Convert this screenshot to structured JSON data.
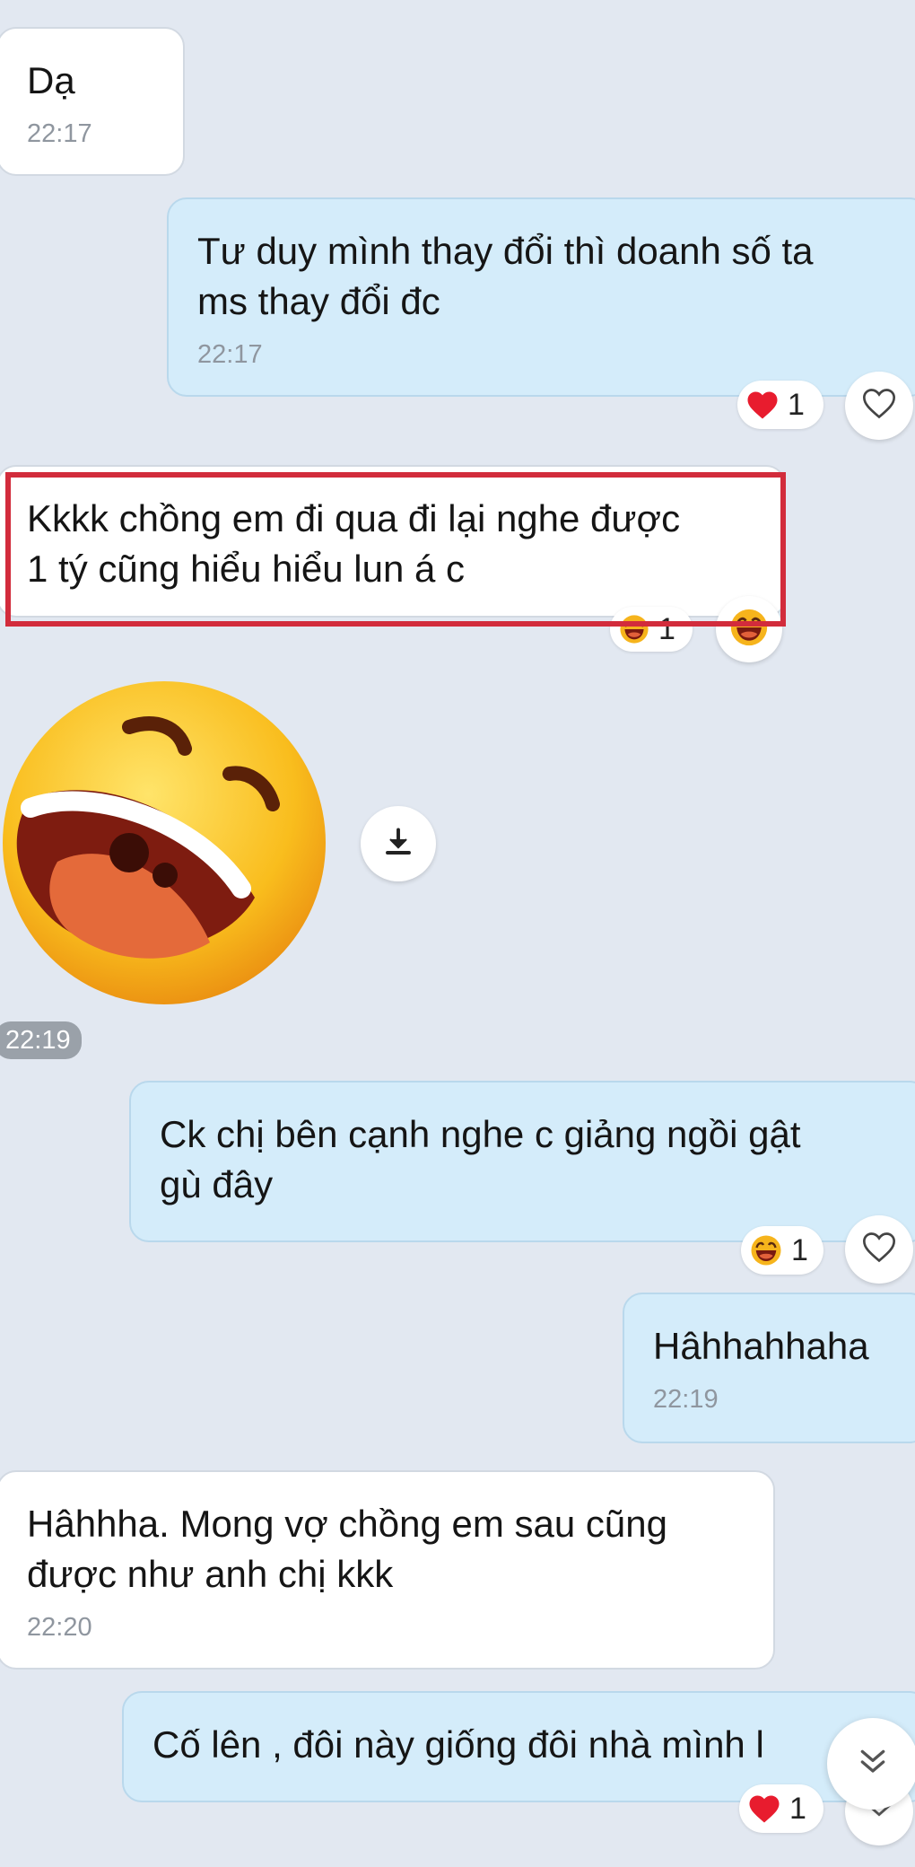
{
  "messages": [
    {
      "text": "Dạ",
      "time": "22:17"
    },
    {
      "text": "Tư duy mình thay đổi thì doanh số ta\nms thay đổi đc",
      "time": "22:17",
      "reaction": {
        "emoji": "heart",
        "count": "1"
      }
    },
    {
      "text": "Kkkk chồng em đi qua đi lại nghe được\n1 tý cũng hiểu hiểu lun á c",
      "reaction": {
        "emoji": "laugh",
        "count": "1"
      }
    },
    {
      "sticker": "laughing-face",
      "time": "22:19"
    },
    {
      "text": "Ck chị bên cạnh nghe c giảng ngồi gật\ngù đây",
      "reaction": {
        "emoji": "laugh",
        "count": "1"
      }
    },
    {
      "text": "Hâhhahhaha",
      "time": "22:19"
    },
    {
      "text": "Hâhhha. Mong vợ chồng em sau cũng\nđược như anh chị kkk",
      "time": "22:20"
    },
    {
      "text": "Cố lên , đôi này giống đôi nhà mình l",
      "reaction": {
        "emoji": "heart",
        "count": "1"
      }
    }
  ],
  "colors": {
    "background": "#e2e8f1",
    "incoming_bubble": "#ffffff",
    "outgoing_bubble": "#d4ecfa",
    "highlight": "#d22c3c"
  },
  "icons": {
    "react": "heart-outline-icon",
    "download": "download-icon",
    "scroll": "chevron-double-down-icon"
  }
}
